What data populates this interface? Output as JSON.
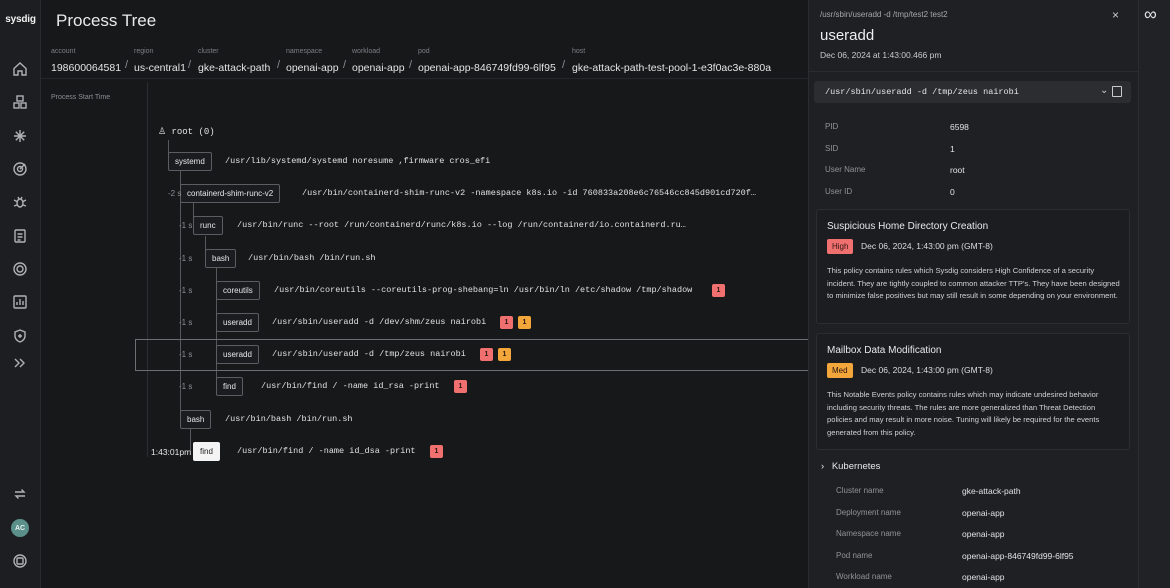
{
  "brand": {
    "logo_text": "sysdig",
    "assistant_icon": "infinity-icon"
  },
  "nav": {
    "icons": [
      "home-icon",
      "inventory-icon",
      "threats-icon",
      "risk-icon",
      "vulnerabilities-icon",
      "compliance-icon",
      "policies-icon",
      "reports-icon",
      "shield-icon",
      "expand-icon"
    ],
    "bottom_icons": [
      "integrations-icon",
      "help-icon"
    ],
    "avatar_initials": "AC"
  },
  "page": {
    "title": "Process Tree"
  },
  "context": {
    "account": {
      "label": "account",
      "value": "198600064581"
    },
    "region": {
      "label": "region",
      "value": "us-central1"
    },
    "cluster": {
      "label": "cluster",
      "value": "gke-attack-path"
    },
    "namespace": {
      "label": "namespace",
      "value": "openai-app"
    },
    "workload": {
      "label": "workload",
      "value": "openai-app"
    },
    "pod": {
      "label": "pod",
      "value": "openai-app-846749fd99-6lf95"
    },
    "host": {
      "label": "host",
      "value": "gke-attack-path-test-pool-1-e3f0ac3e-880a"
    },
    "separator": "/"
  },
  "tree": {
    "column_label": "Process Start Time",
    "root_label": "root (0)",
    "rows": [
      {
        "name": "systemd",
        "cmd": "/usr/lib/systemd/systemd noresume ,firmware cros_efi",
        "duration": ""
      },
      {
        "name": "containerd-shim-runc-v2",
        "cmd": "/usr/bin/containerd-shim-runc-v2 -namespace k8s.io -id 760833a208e6c76546cc845d901cd720f…",
        "duration": "-2 s"
      },
      {
        "name": "runc",
        "cmd": "/usr/bin/runc --root /run/containerd/runc/k8s.io --log /run/containerd/io.containerd.ru…",
        "duration": "-1 s"
      },
      {
        "name": "bash",
        "cmd": "/usr/bin/bash /bin/run.sh",
        "duration": "-1 s"
      },
      {
        "name": "coreutils",
        "cmd": "/usr/bin/coreutils --coreutils-prog-shebang=ln /usr/bin/ln /etc/shadow /tmp/shadow",
        "duration": "-1 s",
        "badges": [
          {
            "sev": "high",
            "count": "1"
          }
        ]
      },
      {
        "name": "useradd",
        "cmd": "/usr/sbin/useradd -d /dev/shm/zeus nairobi",
        "duration": "-1 s",
        "badges": [
          {
            "sev": "high",
            "count": "1"
          },
          {
            "sev": "med",
            "count": "1"
          }
        ]
      },
      {
        "name": "useradd",
        "cmd": "/usr/sbin/useradd -d /tmp/zeus nairobi",
        "duration": "-1 s",
        "badges": [
          {
            "sev": "high",
            "count": "1"
          },
          {
            "sev": "med",
            "count": "1"
          }
        ]
      },
      {
        "name": "find",
        "cmd": "/usr/bin/find / -name id_rsa -print",
        "duration": "-1 s",
        "badges": [
          {
            "sev": "high",
            "count": "1"
          }
        ]
      },
      {
        "name": "bash",
        "cmd": "/usr/bin/bash /bin/run.sh",
        "duration": ""
      },
      {
        "name": "find",
        "cmd": "/usr/bin/find / -name id_dsa -print",
        "duration": "1:43:01pm",
        "badges": [
          {
            "sev": "high",
            "count": "1"
          }
        ]
      }
    ]
  },
  "panel": {
    "path": "/usr/sbin/useradd -d /tmp/test2 test2",
    "close": "×",
    "title": "useradd",
    "date": "Dec 06, 2024 at 1:43:00.466 pm",
    "command": "/usr/sbin/useradd -d /tmp/zeus nairobi",
    "chevron": "⌄",
    "details": [
      {
        "k": "PID",
        "v": "6598"
      },
      {
        "k": "SID",
        "v": "1"
      },
      {
        "k": "User Name",
        "v": "root"
      },
      {
        "k": "User ID",
        "v": "0"
      }
    ],
    "events": [
      {
        "title": "Suspicious Home Directory Creation",
        "severity": "High",
        "time": "Dec 06, 2024, 1:43:00 pm (GMT-8)",
        "description": "This policy contains rules which Sysdig considers High Confidence of a security incident. They are tightly coupled to common attacker TTP's. They have been designed to minimize false positives but may still result in some depending on your environment."
      },
      {
        "title": "Mailbox Data Modification",
        "severity": "Med",
        "time": "Dec 06, 2024, 1:43:00 pm (GMT-8)",
        "description": "This Notable Events policy contains rules which may indicate undesired behavior including security threats. The rules are more generalized than Threat Detection policies and may result in more noise. Tuning will likely be required for the events generated from this policy."
      }
    ],
    "kubernetes": {
      "title": "Kubernetes",
      "chevron": "›",
      "fields": [
        {
          "k": "Cluster name",
          "v": "gke-attack-path"
        },
        {
          "k": "Deployment name",
          "v": "openai-app"
        },
        {
          "k": "Namespace name",
          "v": "openai-app"
        },
        {
          "k": "Pod name",
          "v": "openai-app-846749fd99-6lf95"
        },
        {
          "k": "Workload name",
          "v": "openai-app"
        }
      ]
    }
  },
  "colors": {
    "high": "#f07070",
    "med": "#f3a63a",
    "background": "#17181a",
    "panel": "#1f2023"
  }
}
